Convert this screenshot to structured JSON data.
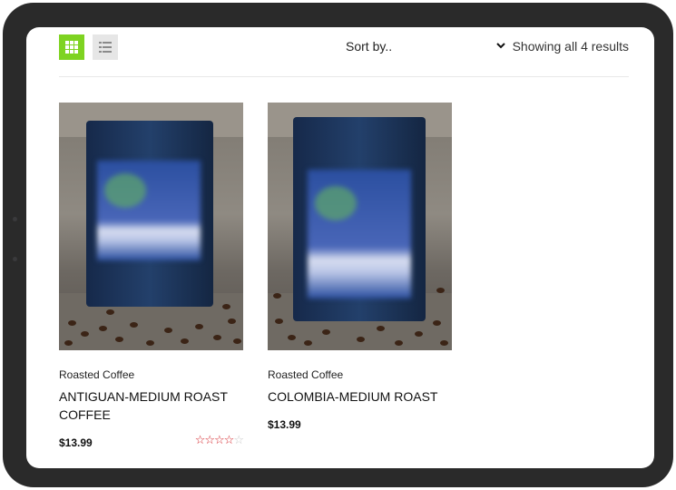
{
  "toolbar": {
    "grid_view_icon": "grid-icon",
    "list_view_icon": "list-icon",
    "sort_label": "Sort by..",
    "sort_caret": "❯",
    "results_text": "Showing all 4 results"
  },
  "colors": {
    "accent": "#7ed321",
    "star": "#d4242a",
    "device_frame": "#2a2a2a"
  },
  "products": [
    {
      "category": "Roasted Coffee",
      "title": "ANTIGUAN-MEDIUM ROAST COFFEE",
      "price": "$13.99",
      "rating": 4,
      "stars_on": "☆☆☆☆",
      "stars_off": "☆"
    },
    {
      "category": "Roasted Coffee",
      "title": "COLOMBIA-MEDIUM ROAST",
      "price": "$13.99"
    }
  ]
}
